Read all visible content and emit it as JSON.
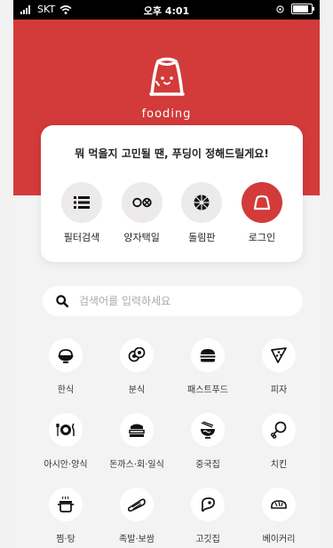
{
  "status": {
    "carrier": "SKT",
    "time": "오후 4:01",
    "battery": 0.9
  },
  "brand": {
    "name": "fooding"
  },
  "card": {
    "title": "뭐 먹을지 고민될 땐, 푸딩이 정해드릴게요!",
    "items": [
      {
        "label": "필터검색",
        "icon": "list-icon"
      },
      {
        "label": "양자택일",
        "icon": "versus-icon"
      },
      {
        "label": "돌림판",
        "icon": "roulette-icon"
      },
      {
        "label": "로그인",
        "icon": "pudding-icon"
      }
    ]
  },
  "search": {
    "placeholder": "검색어를 입력하세요",
    "value": ""
  },
  "categories": [
    {
      "label": "한식",
      "icon": "rice-bowl-icon"
    },
    {
      "label": "분식",
      "icon": "gimbap-icon"
    },
    {
      "label": "패스트푸드",
      "icon": "burger-icon"
    },
    {
      "label": "피자",
      "icon": "pizza-icon"
    },
    {
      "label": "아시안·양식",
      "icon": "plate-fork-knife-icon"
    },
    {
      "label": "돈까스·회·일식",
      "icon": "sushi-icon"
    },
    {
      "label": "중국집",
      "icon": "noodle-bowl-icon"
    },
    {
      "label": "치킨",
      "icon": "drumstick-icon"
    },
    {
      "label": "찜·탕",
      "icon": "pot-icon"
    },
    {
      "label": "족발·보쌈",
      "icon": "pork-feet-icon"
    },
    {
      "label": "고깃집",
      "icon": "steak-icon"
    },
    {
      "label": "베이커리",
      "icon": "bread-icon"
    }
  ],
  "colors": {
    "accent": "#d33a3a",
    "background": "#f3f3f3",
    "card": "#ffffff"
  }
}
